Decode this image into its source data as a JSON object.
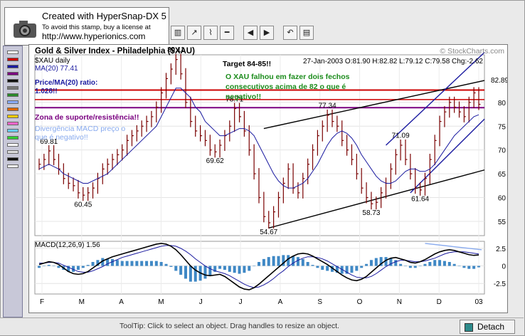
{
  "stamp": {
    "line1": "Created with HyperSnap-DX 5",
    "line2": "To avoid this stamp, buy a license at",
    "line3": "http://www.hyperionics.com"
  },
  "status": {
    "tooltip": "ToolTip: Click to select an object. Drag handles to resize an object.",
    "detach_label": "Detach"
  },
  "colors": {
    "price": "#7a0000",
    "ma": "#1a1aa0",
    "macd_hist": "#3f88c5",
    "support": "#cc0000",
    "resistance": "#7a0080",
    "annot_blue": "#1a1aa0",
    "annot_green": "#1c8c1c"
  },
  "chart": {
    "title": "Gold & Silver Index - Philadelphia ($XAU)",
    "watermark": "© StockCharts.com",
    "legend_price": "$XAU daily",
    "legend_ma": "MA(20) 77.41",
    "header_stats": "27-Jan-2003 O:81.90 H:82.82 L:79.12 C:79.58 Chg:-2.62",
    "target": "Target 84-85!!",
    "ratio_line1": "Price/MA(20) ratio:",
    "ratio_line2": "1.028!!",
    "falhou_1": "O XAU falhou em fazer dois fechos",
    "falhou_2": "consecutivos acima de 82 o que é",
    "falhou_3": "negativo!!",
    "support_text": "Zona de suporte/resistência!!",
    "div_1": "Divergência MACD preço o",
    "div_2": "que é negativo!!",
    "macd_label": "MACD(12,26,9) 1.56"
  },
  "chart_data": {
    "type": "line",
    "title": "Gold & Silver Index - Philadelphia ($XAU)",
    "x_ticks": [
      "F",
      "M",
      "A",
      "M",
      "J",
      "J",
      "A",
      "S",
      "O",
      "N",
      "D",
      "03"
    ],
    "price_axis": {
      "ticks": [
        55,
        60,
        65,
        70,
        75,
        80
      ],
      "range": [
        52,
        90
      ],
      "extra_label": "82.89"
    },
    "macd_axis": {
      "ticks": [
        2.5,
        0,
        -2.5
      ],
      "range": [
        -4,
        3.5
      ]
    },
    "points": [
      {
        "label": "69.81",
        "x": "F",
        "y": 69.81
      },
      {
        "label": "60.45",
        "x": "M",
        "y": 60.45
      },
      {
        "label": "89.11",
        "x": "J",
        "y": 89.11
      },
      {
        "label": "78.71",
        "x": "J",
        "y": 78.71
      },
      {
        "label": "69.62",
        "x": "J",
        "y": 69.62
      },
      {
        "label": "54.67",
        "x": "A",
        "y": 54.67
      },
      {
        "label": "77.34",
        "x": "S",
        "y": 77.34
      },
      {
        "label": "58.73",
        "x": "O",
        "y": 58.73
      },
      {
        "label": "71.09",
        "x": "N",
        "y": 71.09
      },
      {
        "label": "61.64",
        "x": "D",
        "y": 61.64
      }
    ],
    "closes": [
      67,
      68,
      69.8,
      68,
      66,
      64,
      63,
      62.5,
      61,
      60.5,
      61,
      62,
      64,
      66,
      67,
      68,
      69,
      70,
      72,
      73,
      74,
      75,
      76,
      77,
      79,
      82,
      85,
      87,
      89,
      86,
      80,
      76,
      74,
      73,
      72,
      70,
      69.6,
      71,
      73,
      75,
      78.7,
      77,
      74,
      70,
      65,
      60,
      56,
      54.7,
      57,
      60,
      63,
      66,
      62,
      61,
      64,
      67,
      70,
      73,
      75,
      77.3,
      76,
      75,
      72,
      70,
      68,
      65,
      62,
      60,
      58.7,
      59,
      61,
      63,
      66,
      69,
      71,
      68,
      65,
      62,
      61.6,
      64,
      68,
      72,
      76,
      78,
      80,
      79,
      78,
      77,
      80,
      82,
      79.6
    ],
    "ma20": [
      66,
      66.5,
      67,
      66.5,
      66,
      65,
      64.5,
      64,
      63.5,
      63,
      63,
      63.5,
      64,
      64.5,
      65,
      66,
      67,
      68,
      69,
      70,
      71,
      72,
      73,
      74,
      75,
      77,
      79,
      81,
      83,
      83,
      82,
      81,
      79,
      78,
      76,
      75,
      74,
      73,
      73,
      73.5,
      74,
      74.5,
      74.5,
      74,
      73,
      71,
      69,
      67,
      65,
      63.5,
      62.5,
      62,
      62,
      62.5,
      63,
      64,
      65.5,
      67,
      69,
      71,
      72.5,
      73.5,
      74,
      73.5,
      72.5,
      71,
      69,
      67.5,
      66,
      64.5,
      63.5,
      63,
      63,
      63.5,
      64.5,
      65.5,
      66,
      66,
      65.5,
      65.5,
      66,
      67,
      68.5,
      70,
      71.5,
      73,
      74,
      75,
      76,
      77,
      77.4
    ],
    "macd": [
      0.2,
      0.4,
      0.6,
      0.5,
      0.2,
      -0.3,
      -0.8,
      -1.1,
      -1.2,
      -1.1,
      -0.8,
      -0.3,
      0.2,
      0.7,
      1,
      1.3,
      1.5,
      1.7,
      1.9,
      2.1,
      2.3,
      2.5,
      2.7,
      2.9,
      3.1,
      3.2,
      3.1,
      2.8,
      2.3,
      1.6,
      0.8,
      0,
      -0.6,
      -1,
      -1.3,
      -1.4,
      -1.3,
      -1.2,
      -1.5,
      -2,
      -2.5,
      -3,
      -3.3,
      -3.4,
      -3.1,
      -2.6,
      -2,
      -1.4,
      -0.8,
      -0.2,
      0.4,
      1,
      1.4,
      1.7,
      1.8,
      1.7,
      1.4,
      1,
      0.6,
      0.2,
      -0.3,
      -0.8,
      -1.3,
      -1.7,
      -2,
      -2.1,
      -1.9,
      -1.5,
      -0.9,
      -0.3,
      0.3,
      0.8,
      1.1,
      1.2,
      1,
      0.8,
      0.5,
      0.4,
      0.6,
      0.9,
      1.3,
      1.7,
      2,
      2.2,
      2.3,
      2.2,
      2,
      1.8,
      1.6,
      1.5,
      1.56
    ],
    "signal": [
      0.4,
      0.4,
      0.5,
      0.5,
      0.4,
      0.1,
      -0.2,
      -0.5,
      -0.8,
      -0.9,
      -0.9,
      -0.7,
      -0.4,
      -0.1,
      0.3,
      0.6,
      0.9,
      1.2,
      1.4,
      1.6,
      1.8,
      2,
      2.2,
      2.4,
      2.6,
      2.8,
      2.9,
      2.9,
      2.8,
      2.5,
      2.1,
      1.6,
      1,
      0.5,
      0,
      -0.4,
      -0.7,
      -0.9,
      -1.1,
      -1.4,
      -1.8,
      -2.2,
      -2.6,
      -2.9,
      -3.1,
      -3,
      -2.7,
      -2.3,
      -1.8,
      -1.2,
      -0.7,
      -0.1,
      0.4,
      0.8,
      1.1,
      1.3,
      1.3,
      1.2,
      1,
      0.7,
      0.3,
      -0.1,
      -0.5,
      -0.9,
      -1.3,
      -1.6,
      -1.7,
      -1.7,
      -1.5,
      -1.1,
      -0.6,
      -0.1,
      0.3,
      0.6,
      0.8,
      0.8,
      0.7,
      0.6,
      0.6,
      0.7,
      0.9,
      1.1,
      1.4,
      1.7,
      1.9,
      2,
      2,
      2,
      1.9,
      1.8,
      1.7
    ]
  }
}
